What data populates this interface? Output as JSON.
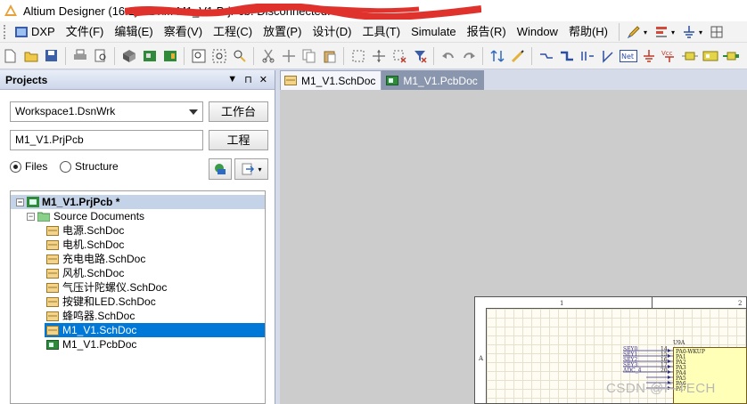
{
  "titlebar": {
    "title": "Altium Designer (16.1) - D:\\... M1_V1.PrjPcb. Disconnected."
  },
  "menu": {
    "items": [
      "DXP",
      "文件(F)",
      "编辑(E)",
      "察看(V)",
      "工程(C)",
      "放置(P)",
      "设计(D)",
      "工具(T)",
      "Simulate",
      "报告(R)",
      "Window",
      "帮助(H)"
    ]
  },
  "panel": {
    "title": "Projects",
    "workspace_value": "Workspace1.DsnWrk",
    "workspace_button": "工作台",
    "project_value": "M1_V1.PrjPcb",
    "project_button": "工程",
    "radio_files": "Files",
    "radio_structure": "Structure",
    "radio_selected": "Files"
  },
  "tree": {
    "project": "M1_V1.PrjPcb *",
    "source_folder": "Source Documents",
    "documents": [
      "电源.SchDoc",
      "电机.SchDoc",
      "充电电路.SchDoc",
      "风机.SchDoc",
      "气压计陀螺仪.SchDoc",
      "按键和LED.SchDoc",
      "蜂鸣器.SchDoc",
      "M1_V1.SchDoc",
      "M1_V1.PcbDoc"
    ],
    "selected": "M1_V1.SchDoc"
  },
  "tabs": {
    "active": "M1_V1.SchDoc",
    "inactive": "M1_V1.PcbDoc"
  },
  "schematic": {
    "col_labels": [
      "1",
      "2"
    ],
    "row_label": "A",
    "chip_ref": "U9A",
    "pins": [
      "PA0-WKUP",
      "PA1",
      "PA2",
      "PA3",
      "PA4",
      "PA5",
      "PA6",
      "PA7"
    ],
    "nets": [
      "SEY0",
      "SEY1",
      "SEY2",
      "SEY3",
      "ADC_4",
      "",
      "",
      ""
    ],
    "pin_numbers": [
      "14",
      "15",
      "16",
      "17",
      "20",
      "21",
      "22",
      "23"
    ]
  },
  "watermark": "CSDN @F-TECH",
  "colors": {
    "selection": "#0078d7",
    "project_row": "#c5d3e8",
    "doc_bg": "#cccccc",
    "chip_fill": "#ffffb8"
  }
}
